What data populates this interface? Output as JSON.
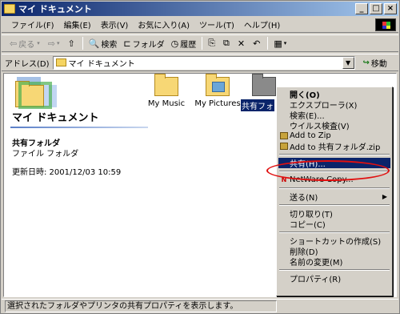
{
  "window": {
    "title": "マイ ドキュメント"
  },
  "menu": [
    "ファイル(F)",
    "編集(E)",
    "表示(V)",
    "お気に入り(A)",
    "ツール(T)",
    "ヘルプ(H)"
  ],
  "toolbar": {
    "back": "戻る",
    "search": "検索",
    "folders": "フォルダ",
    "history": "履歴"
  },
  "address": {
    "label": "アドレス(D)",
    "value": "マイ ドキュメント",
    "go": "移動"
  },
  "panel": {
    "title": "マイ ドキュメント",
    "selected_name": "共有フォルダ",
    "selected_type": "ファイル フォルダ",
    "modified": "更新日時: 2001/12/03 10:59"
  },
  "files": [
    {
      "name": "My Music"
    },
    {
      "name": "My Pictures"
    },
    {
      "name": "共有フォ"
    }
  ],
  "context_menu": {
    "open": "開く(O)",
    "explorer": "エクスプローラ(X)",
    "search": "検索(E)...",
    "virus": "ウイルス検査(V)",
    "add_zip": "Add to Zip",
    "add_named_zip": "Add to 共有フォルダ.zip",
    "share": "共有(H)...",
    "netware": "NetWare Copy...",
    "send_to": "送る(N)",
    "cut": "切り取り(T)",
    "copy": "コピー(C)",
    "shortcut": "ショートカットの作成(S)",
    "delete": "削除(D)",
    "rename": "名前の変更(M)",
    "properties": "プロパティ(R)"
  },
  "status": {
    "text": "選択されたフォルダやプリンタの共有プロパティを表示します。"
  },
  "colors": {
    "title_start": "#0a246a",
    "title_end": "#a6caf0",
    "highlight": "#0a246a",
    "annotation": "#e01010"
  }
}
